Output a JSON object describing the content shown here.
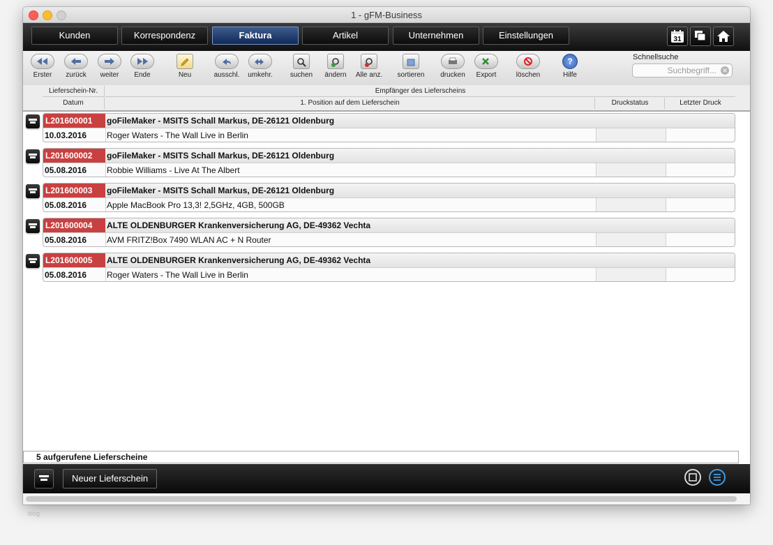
{
  "window": {
    "title": "1 - gFM-Business"
  },
  "nav": {
    "tabs": [
      {
        "label": "Kunden",
        "active": false
      },
      {
        "label": "Korrespondenz",
        "active": false
      },
      {
        "label": "Faktura",
        "active": true
      },
      {
        "label": "Artikel",
        "active": false
      },
      {
        "label": "Unternehmen",
        "active": false
      },
      {
        "label": "Einstellungen",
        "active": false
      }
    ],
    "calendar_day": "31",
    "icons": [
      "calendar-icon",
      "windows-icon",
      "home-icon"
    ]
  },
  "toolbar": {
    "buttons": [
      {
        "label": "Erster",
        "icon": "first-icon"
      },
      {
        "label": "zurück",
        "icon": "back-icon"
      },
      {
        "label": "weiter",
        "icon": "forward-icon"
      },
      {
        "label": "Ende",
        "icon": "last-icon"
      },
      {
        "label": "Neu",
        "icon": "new-icon"
      },
      {
        "label": "ausschl.",
        "icon": "exclude-icon"
      },
      {
        "label": "umkehr.",
        "icon": "invert-icon"
      },
      {
        "label": "suchen",
        "icon": "search-icon"
      },
      {
        "label": "ändern",
        "icon": "modify-icon"
      },
      {
        "label": "Alle anz.",
        "icon": "show-all-icon"
      },
      {
        "label": "sortieren",
        "icon": "sort-icon"
      },
      {
        "label": "drucken",
        "icon": "print-icon"
      },
      {
        "label": "Export",
        "icon": "export-icon"
      },
      {
        "label": "löschen",
        "icon": "delete-icon"
      },
      {
        "label": "Hilfe",
        "icon": "help-icon"
      }
    ],
    "quicksearch": {
      "label": "Schnellsuche",
      "placeholder": "Suchbegriff..."
    }
  },
  "columns": {
    "nr": "Lieferschein-Nr.",
    "receiver": "Empfänger des Lieferscheins",
    "date": "Datum",
    "position": "1. Position auf dem Lieferschein",
    "print_status": "Druckstatus",
    "last_print": "Letzter Druck"
  },
  "records": [
    {
      "id": "L201600001",
      "receiver": "goFileMaker - MSITS Schall Markus, DE-26121 Oldenburg",
      "date": "10.03.2016",
      "position": "Roger Waters - The Wall Live in Berlin"
    },
    {
      "id": "L201600002",
      "receiver": "goFileMaker - MSITS Schall Markus, DE-26121 Oldenburg",
      "date": "05.08.2016",
      "position": "Robbie Williams - Live At The Albert"
    },
    {
      "id": "L201600003",
      "receiver": "goFileMaker - MSITS Schall Markus, DE-26121 Oldenburg",
      "date": "05.08.2016",
      "position": "Apple MacBook Pro 13,3! 2,5GHz, 4GB, 500GB"
    },
    {
      "id": "L201600004",
      "receiver": "ALTE OLDENBURGER Krankenversicherung AG, DE-49362 Vechta",
      "date": "05.08.2016",
      "position": "AVM FRITZ!Box 7490 WLAN AC + N Router"
    },
    {
      "id": "L201600005",
      "receiver": "ALTE OLDENBURGER Krankenversicherung AG, DE-49362 Vechta",
      "date": "05.08.2016",
      "position": "Roger Waters - The Wall Live in Berlin"
    }
  ],
  "status": "5 aufgerufene Lieferscheine",
  "footer": {
    "new_label": "Neuer Lieferschein"
  },
  "colors": {
    "id_badge": "#c94040",
    "active_tab": "#1f3c6e"
  },
  "watermark": "blog"
}
